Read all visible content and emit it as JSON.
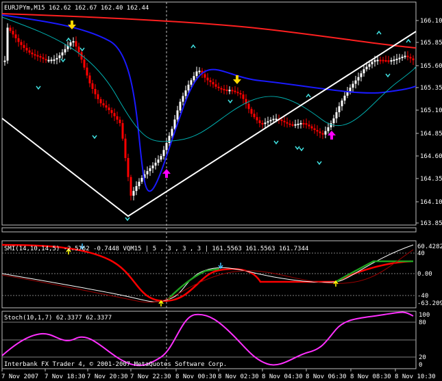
{
  "main": {
    "header": "EURJPYm,M15  162.62 162.67 162.40 162.44",
    "y_ticks": [
      "166.10",
      "165.85",
      "165.60",
      "165.35",
      "165.10",
      "164.85",
      "164.60",
      "164.35",
      "164.10",
      "163.85"
    ]
  },
  "smi": {
    "header": "SMI(14,10,14,5) -2.5762 -0.7448  VQM15 | 5 , 3 , 3 , 3  |  161.5563 161.5563 161.7344",
    "y_ticks": [
      "60.4282",
      "40",
      "0.00",
      "-40",
      "-63.2098"
    ]
  },
  "stoch": {
    "header": "Stoch(10,1,7) 62.3377 62.3377",
    "y_ticks": [
      "100",
      "80",
      "20",
      "0"
    ]
  },
  "footer": "Interbank FX Trader 4, © 2001-2007 MetaQuotes Software Corp.",
  "x_labels": [
    "7 Nov 2007",
    "7 Nov 18:30",
    "7 Nov 20:30",
    "7 Nov 22:30",
    "8 Nov 00:30",
    "8 Nov 02:30",
    "8 Nov 04:30",
    "8 Nov 06:30",
    "8 Nov 08:30",
    "8 Nov 10:30"
  ],
  "colors": {
    "bull": "#ffffff",
    "bear": "#ff0000",
    "ma_slow": "#ff2020",
    "ma_mid": "#1a1aff",
    "ma_fast": "#00b0b0",
    "arrow_up": "#ff00ff",
    "arrow_down": "#ffd700",
    "stoch": "#ff30ff"
  }
}
